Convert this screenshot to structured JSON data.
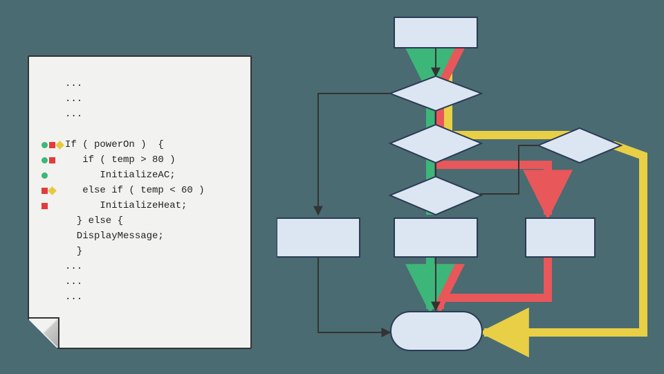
{
  "colors": {
    "green": "#3db67a",
    "red": "#e8575a",
    "yellow": "#e9cf46",
    "node_fill": "#dbe6f2",
    "node_stroke": "#2b3a55",
    "edge": "#333",
    "bg": "#4a6b71",
    "paper": "#f2f2f0"
  },
  "code": {
    "lines": [
      {
        "markers": [],
        "text": "..."
      },
      {
        "markers": [],
        "text": "..."
      },
      {
        "markers": [],
        "text": "..."
      },
      {
        "markers": [],
        "text": ""
      },
      {
        "markers": [
          "green",
          "red",
          "yellow"
        ],
        "text": "If ( powerOn )  {"
      },
      {
        "markers": [
          "green",
          "red"
        ],
        "text": "   if ( temp > 80 )"
      },
      {
        "markers": [
          "green"
        ],
        "text": "      InitializeAC;"
      },
      {
        "markers": [
          "red",
          "yellow"
        ],
        "text": "   else if ( temp < 60 )"
      },
      {
        "markers": [
          "red"
        ],
        "text": "      InitializeHeat;"
      },
      {
        "markers": [],
        "text": "  } else {"
      },
      {
        "markers": [],
        "text": "  DisplayMessage;"
      },
      {
        "markers": [],
        "text": "  }"
      },
      {
        "markers": [],
        "text": "..."
      },
      {
        "markers": [],
        "text": "..."
      },
      {
        "markers": [],
        "text": "..."
      }
    ]
  },
  "diagram": {
    "paths": [
      "green",
      "red",
      "yellow"
    ],
    "nodes": [
      {
        "id": "start",
        "type": "rect",
        "label": ""
      },
      {
        "id": "cond_powerOn",
        "type": "diamond",
        "label": ""
      },
      {
        "id": "cond_tempHot",
        "type": "diamond",
        "label": ""
      },
      {
        "id": "cond_tempCold",
        "type": "diamond",
        "label": ""
      },
      {
        "id": "diamond_right",
        "type": "diamond",
        "label": ""
      },
      {
        "id": "proc_displayMessage",
        "type": "rect",
        "label": ""
      },
      {
        "id": "proc_initAC",
        "type": "rect",
        "label": ""
      },
      {
        "id": "proc_initHeat",
        "type": "rect",
        "label": ""
      },
      {
        "id": "end",
        "type": "terminator",
        "label": ""
      }
    ]
  }
}
